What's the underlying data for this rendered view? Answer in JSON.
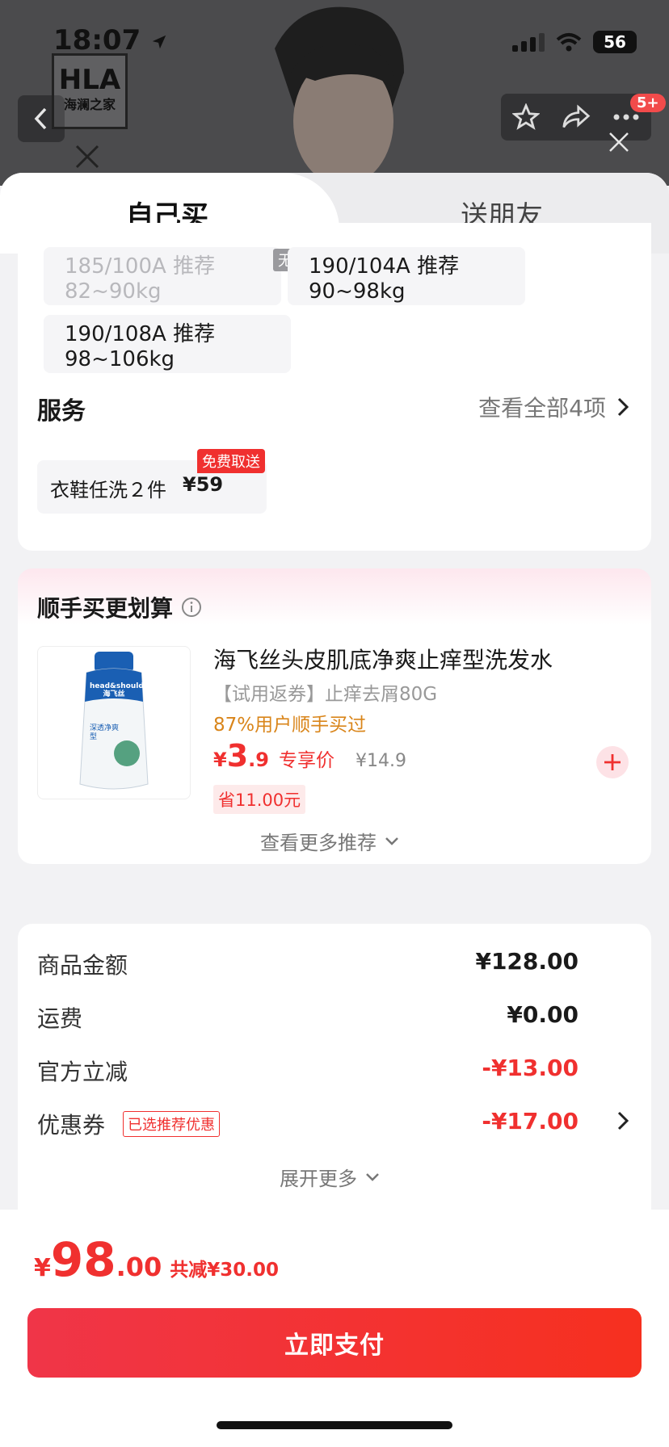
{
  "status": {
    "time": "18:07",
    "battery": "56"
  },
  "brand": {
    "logo_big": "HLA",
    "logo_small": "海澜之家"
  },
  "header": {
    "badge": "5+"
  },
  "tabs": [
    {
      "label": "自己买"
    },
    {
      "label": "送朋友"
    }
  ],
  "sizes": {
    "sold_out_tag": "无货",
    "items": [
      {
        "label": "185/100A 推荐 82~90kg",
        "available": false
      },
      {
        "label": "190/104A 推荐 90~98kg",
        "available": true
      },
      {
        "label": "190/108A 推荐 98~106kg",
        "available": true
      }
    ]
  },
  "service": {
    "title": "服务",
    "view_all": "查看全部4项",
    "item": {
      "name": "衣鞋任洗２件",
      "price": "¥59",
      "tag": "免费取送"
    }
  },
  "addon": {
    "title": "顺手买更划算",
    "product": {
      "name": "海飞丝头皮肌底净爽止痒型洗发水",
      "desc": "【试用返券】止痒去屑80G",
      "social": "87%用户顺手买过",
      "currency": "¥",
      "price_int": "3",
      "price_dec": ".9",
      "price_label": "专享价",
      "original": "¥14.9",
      "save": "省11.00元",
      "image_brand": "head&shoulders",
      "image_brand_cn": "海飞丝",
      "image_type": "深透净爽型"
    },
    "more": "查看更多推荐"
  },
  "summary": {
    "rows": [
      {
        "label": "商品金额",
        "value": "¥128.00",
        "color": "#1a1a1a"
      },
      {
        "label": "运费",
        "value": "¥0.00",
        "color": "#1a1a1a"
      },
      {
        "label": "官方立减",
        "value": "-¥13.00",
        "color": "#f0302f"
      },
      {
        "label": "优惠券",
        "value": "-¥17.00",
        "color": "#f0302f"
      }
    ],
    "coupon_tag": "已选推荐优惠",
    "expand": "展开更多"
  },
  "pay": {
    "currency": "¥",
    "amount_int": "98",
    "amount_dec": ".00",
    "total_off": "共减¥30.00",
    "button": "立即支付"
  },
  "colors": {
    "accent": "#f0302f",
    "price_orange": "#d9851a"
  }
}
